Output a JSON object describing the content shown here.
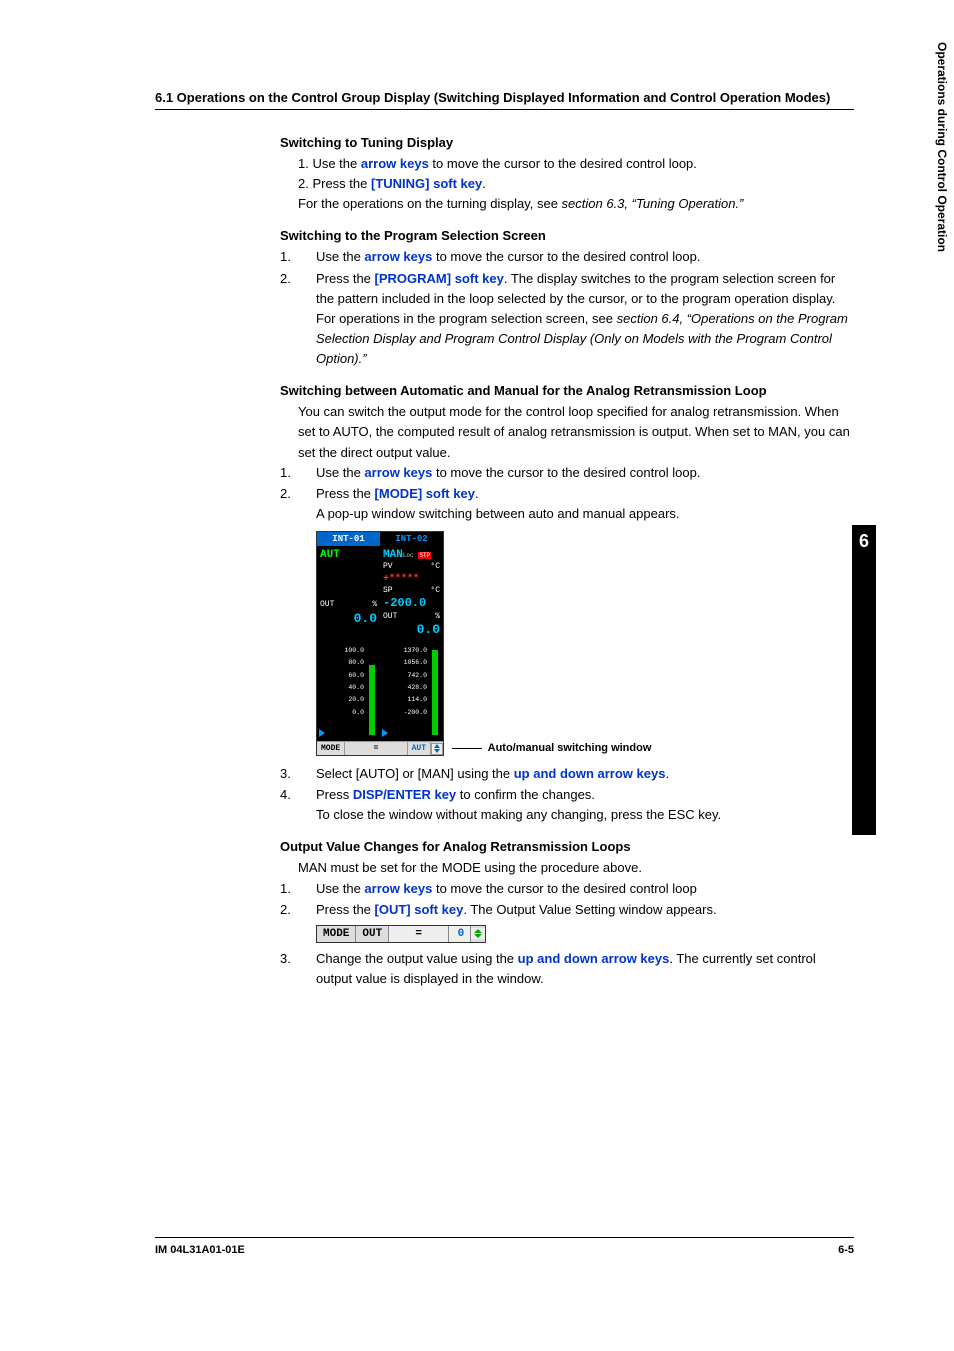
{
  "header": "6.1  Operations on the Control Group Display (Switching Displayed Information and Control Operation Modes)",
  "sideTab": {
    "num": "6",
    "label": "Operations during Control Operation"
  },
  "footer": {
    "left": "IM 04L31A01-01E",
    "right": "6-5"
  },
  "sec1": {
    "title": "Switching to Tuning Display",
    "li1a": "1.  Use the ",
    "li1key": "arrow keys",
    "li1b": " to move the cursor to the desired control loop.",
    "li2a": "2.  Press the ",
    "li2key": "[TUNING] soft key",
    "li2b": ".",
    "note_a": "For the operations on the turning display, see ",
    "note_i": "section 6.3, “Tuning Operation.”"
  },
  "sec2": {
    "title": "Switching to the Program Selection Screen",
    "li1n": "1.",
    "li1a": "Use the ",
    "li1key": "arrow keys",
    "li1b": " to move the cursor to the desired control loop.",
    "li2n": "2.",
    "li2a": "Press the ",
    "li2key": "[PROGRAM] soft key",
    "li2b": ".  The display switches to the program selection screen for the pattern included in the loop selected by the cursor, or to the program operation display.",
    "li2c_a": "For operations in the program selection screen, see ",
    "li2c_i": "section 6.4, “Operations on the Program Selection Display and Program Control Display (Only on Models with the Program Control Option).”"
  },
  "sec3": {
    "title": "Switching between Automatic and Manual for the Analog Retransmission Loop",
    "intro": "You can switch the output mode for the control loop specified for analog retransmission.  When set to AUTO, the computed result of analog retransmission is output.  When set to MAN, you can set the direct output value.",
    "li1n": "1.",
    "li1a": "Use the ",
    "li1key": "arrow keys",
    "li1b": " to move the cursor to the desired control loop.",
    "li2n": "2.",
    "li2a": "Press the ",
    "li2key": "[MODE] soft key",
    "li2b": ".",
    "li2c": "A pop-up window switching between auto and manual appears.",
    "callout": "Auto/manual switching window",
    "li3n": "3.",
    "li3a": "Select [AUTO] or [MAN] using the ",
    "li3key": "up and down arrow keys",
    "li3b": ".",
    "li4n": "4.",
    "li4a": "Press ",
    "li4key": "DISP/ENTER key",
    "li4b": " to confirm the changes.",
    "li4c": "To close the window without making any changing, press the ESC key."
  },
  "sec4": {
    "title": "Output Value Changes for Analog Retransmission Loops",
    "intro": "MAN must be set for the MODE using the procedure above.",
    "li1n": "1.",
    "li1a": "Use the ",
    "li1key": "arrow keys",
    "li1b": " to move the cursor to the desired control loop",
    "li2n": "2.",
    "li2a": "Press the ",
    "li2key": "[OUT] soft key",
    "li2b": ".  The Output Value Setting window appears.",
    "li3n": "3.",
    "li3a": "Change the output value using the ",
    "li3key": "up and down arrow keys",
    "li3b": ".  The currently set control output value is displayed in the window."
  },
  "lcd": {
    "tab1": "INT-01",
    "tab2": "INT-02",
    "p1": {
      "mode": "AUT",
      "out_lbl": "OUT",
      "out_unit": "%",
      "out_val": "0.0",
      "ticks": [
        "100.0",
        "80.0",
        "60.0",
        "40.0",
        "20.0",
        "0.0"
      ]
    },
    "p2": {
      "mode": "MAN",
      "loc": "Loc",
      "stp": "STP",
      "pv_lbl": "PV",
      "pv_unit": "°C",
      "pv_val": "+*****",
      "sp_lbl": "SP",
      "sp_unit": "°C",
      "sp_val": "-200.0",
      "out_lbl": "OUT",
      "out_unit": "%",
      "out_val": "0.0",
      "ticks": [
        "1370.0",
        "1056.0",
        "742.0",
        "428.0",
        "114.0",
        "-200.0"
      ]
    },
    "bottom": {
      "mode": "MODE",
      "eq": "=",
      "aut": "AUT"
    }
  },
  "modeout": {
    "mode": "MODE",
    "out": "OUT",
    "eq": "=",
    "val": "0"
  }
}
